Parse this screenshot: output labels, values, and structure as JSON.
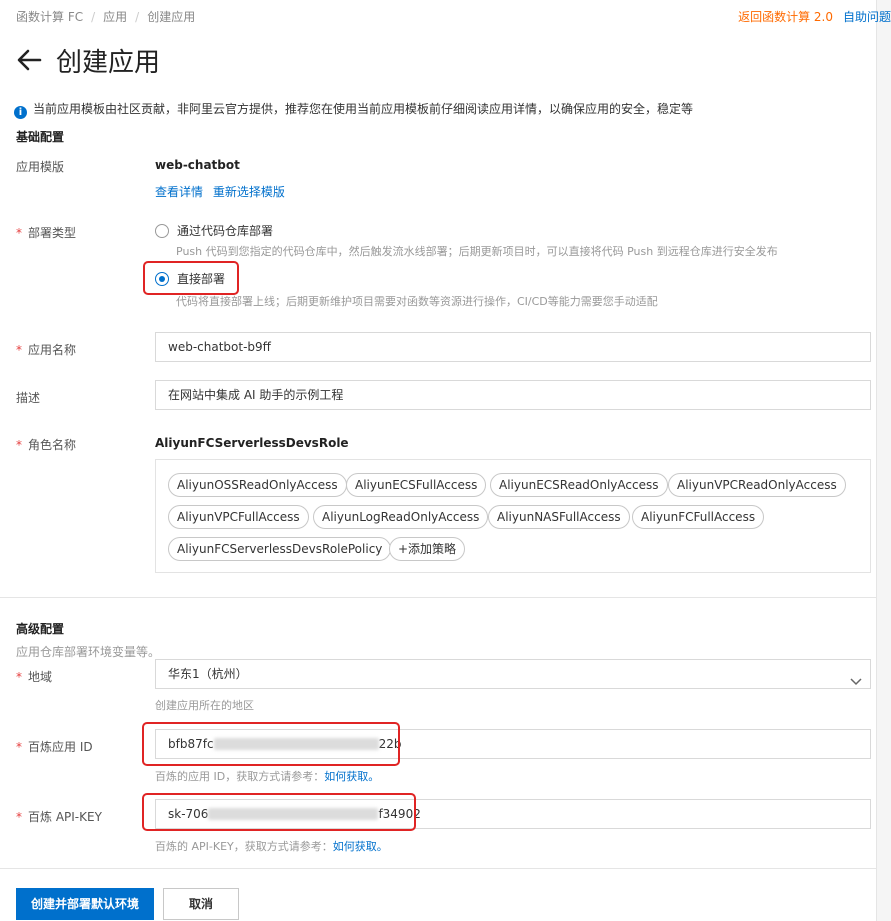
{
  "breadcrumb": {
    "items": [
      "函数计算 FC",
      "应用",
      "创建应用"
    ]
  },
  "top_links": {
    "back_v2": "返回函数计算 2.0",
    "self_help": "自助问题"
  },
  "page_title": "创建应用",
  "notice": "当前应用模板由社区贡献，非阿里云官方提供，推荐您在使用当前应用模板前仔细阅读应用详情，以确保应用的安全，稳定等",
  "basic": {
    "section_title": "基础配置",
    "template_label": "应用模版",
    "template_value": "web-chatbot",
    "view_details": "查看详情",
    "reselect": "重新选择模版",
    "deploy_type_label": "部署类型",
    "deploy_options": [
      {
        "label": "通过代码仓库部署",
        "desc": "Push 代码到您指定的代码仓库中，然后触发流水线部署；后期更新项目时，可以直接将代码 Push 到远程仓库进行安全发布",
        "selected": false
      },
      {
        "label": "直接部署",
        "desc": "代码将直接部署上线；后期更新维护项目需要对函数等资源进行操作，CI/CD等能力需要您手动适配",
        "selected": true
      }
    ],
    "app_name_label": "应用名称",
    "app_name_value": "web-chatbot-b9ff",
    "desc_label": "描述",
    "desc_value": "在网站中集成 AI 助手的示例工程",
    "role_label": "角色名称",
    "role_value": "AliyunFCServerlessDevsRole",
    "policies": [
      "AliyunOSSReadOnlyAccess",
      "AliyunECSFullAccess",
      "AliyunECSReadOnlyAccess",
      "AliyunVPCReadOnlyAccess",
      "AliyunVPCFullAccess",
      "AliyunLogReadOnlyAccess",
      "AliyunNASFullAccess",
      "AliyunFCFullAccess",
      "AliyunFCServerlessDevsRolePolicy"
    ],
    "add_policy": "+添加策略"
  },
  "advanced": {
    "section_title": "高级配置",
    "section_desc": "应用仓库部署环境变量等。",
    "region_label": "地域",
    "region_value": "华东1（杭州）",
    "region_hint": "创建应用所在的地区",
    "bailian_id_label": "百炼应用 ID",
    "bailian_id_prefix": "bfb87fc",
    "bailian_id_suffix": "22b",
    "bailian_id_hint": "百炼的应用 ID，获取方式请参考：",
    "bailian_id_link": "如何获取。",
    "api_key_label": "百炼 API-KEY",
    "api_key_prefix": "sk-706",
    "api_key_suffix": "f34902",
    "api_key_hint": "百炼的 API-KEY，获取方式请参考：",
    "api_key_link": "如何获取。"
  },
  "actions": {
    "create": "创建并部署默认环境",
    "cancel": "取消"
  },
  "colors": {
    "primary": "#0070cc",
    "orange": "#ff6a00",
    "highlight": "#e02424",
    "required": "#e53e3e"
  },
  "icons": {
    "back": "arrow-left-icon",
    "info": "info-icon",
    "dropdown": "chevron-down-icon"
  }
}
